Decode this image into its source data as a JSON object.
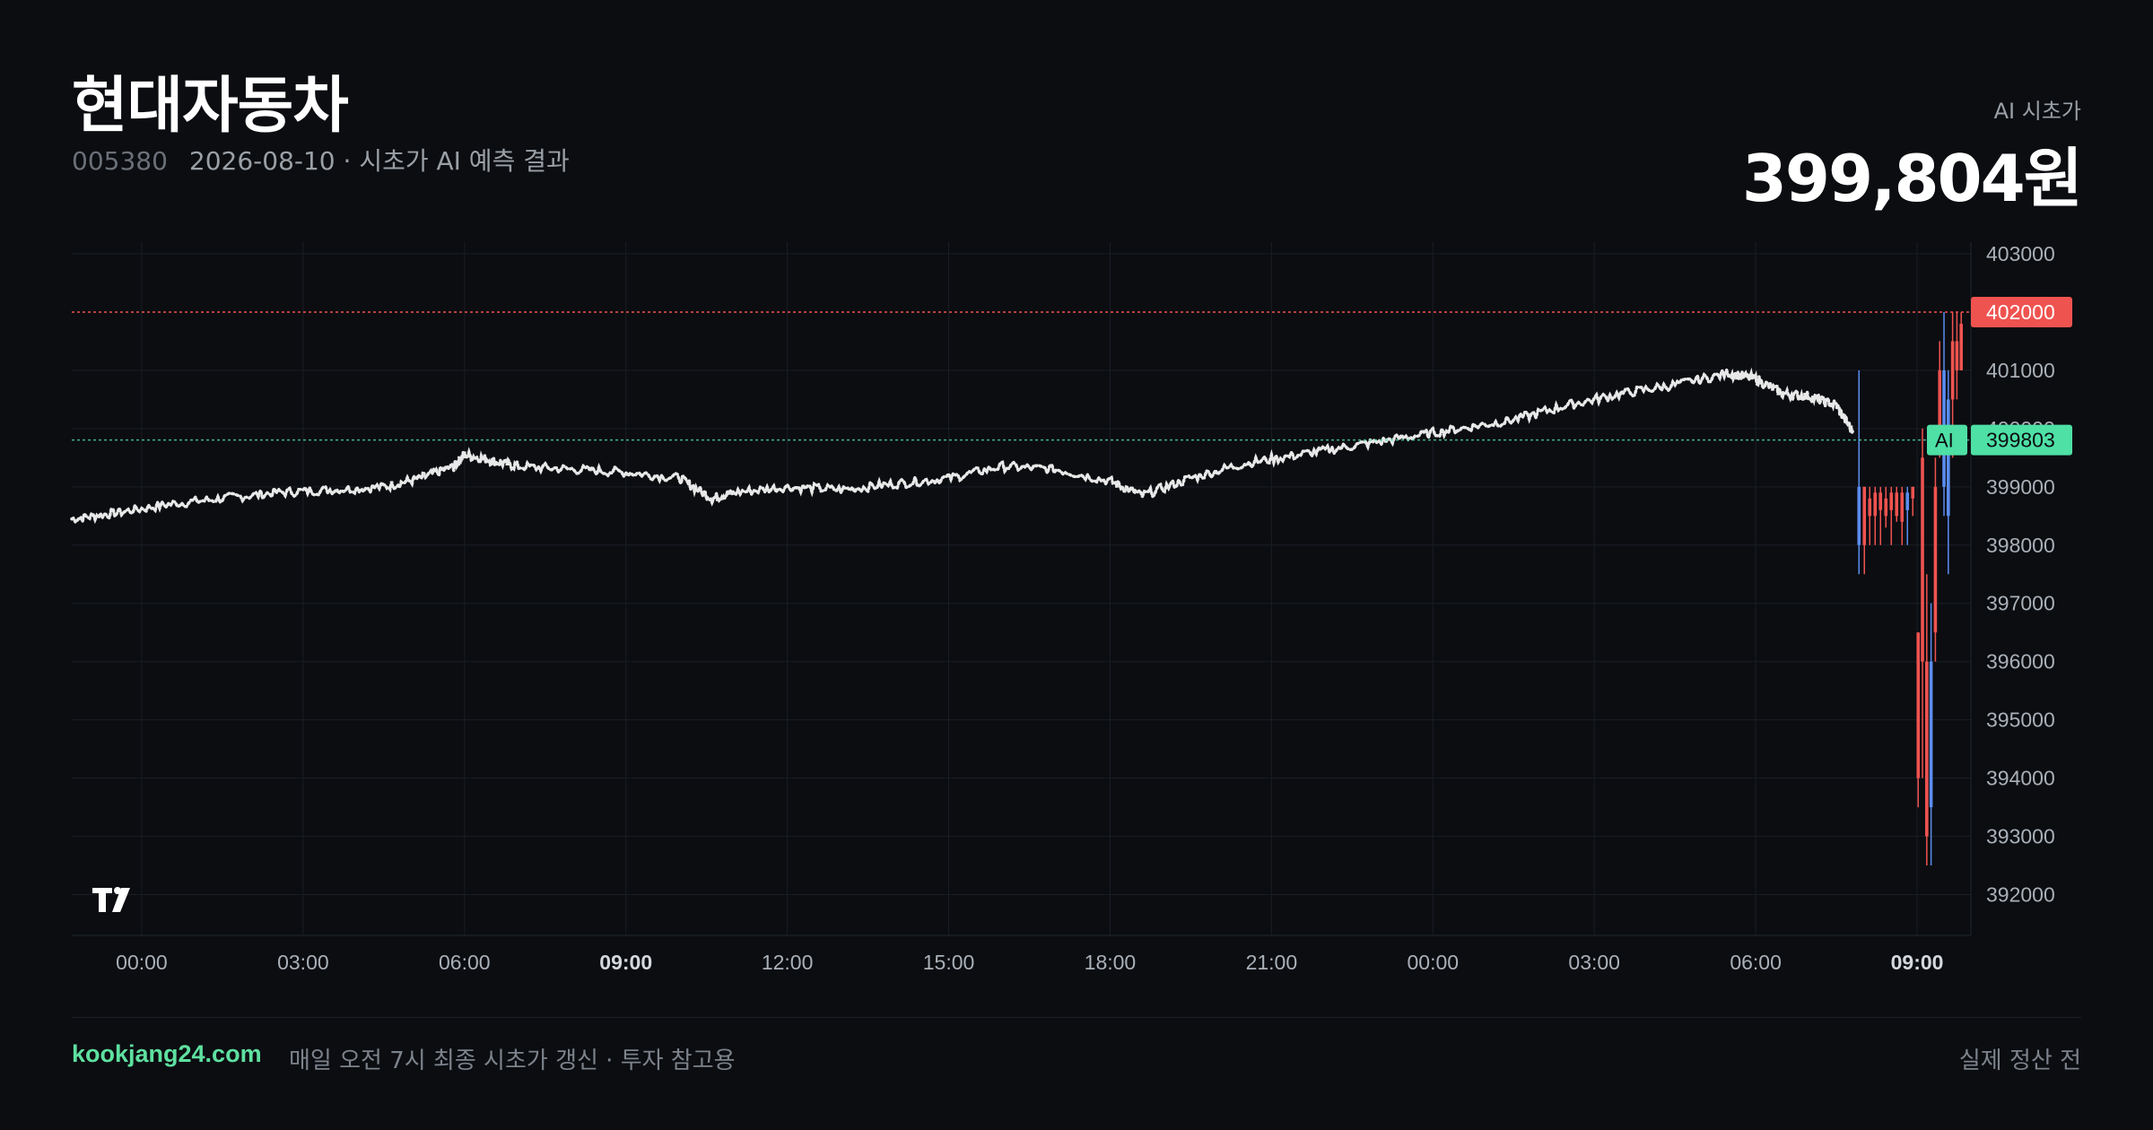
{
  "header": {
    "title": "현대자동차",
    "code": "005380",
    "subtitle": "2026-08-10 · 시초가 AI 예측 결과",
    "pred_label": "AI 시초가",
    "pred_value": "399,804원"
  },
  "footer": {
    "site": "kookjang24.com",
    "note": "매일 오전 7시 최종 시초가 갱신 · 투자 참고용",
    "status": "실제 정산 전"
  },
  "colors": {
    "background": "#0b0d11",
    "line": "#e8e8e8",
    "ref_line": "#ef5350",
    "ai_line": "#4ee0a5",
    "candle_up": "#ef5350",
    "candle_down": "#5b8def",
    "grid": "#1a1e25"
  },
  "chart_data": {
    "type": "line",
    "ylim": [
      391300,
      403200
    ],
    "yticks": [
      403000,
      401000,
      399000,
      398000,
      397000,
      396000,
      395000,
      394000,
      393000,
      392000
    ],
    "xticks": [
      {
        "t": 0,
        "label": "00:00",
        "bold": false
      },
      {
        "t": 3,
        "label": "03:00",
        "bold": false
      },
      {
        "t": 6,
        "label": "06:00",
        "bold": false
      },
      {
        "t": 9,
        "label": "09:00",
        "bold": true
      },
      {
        "t": 12,
        "label": "12:00",
        "bold": false
      },
      {
        "t": 15,
        "label": "15:00",
        "bold": false
      },
      {
        "t": 18,
        "label": "18:00",
        "bold": false
      },
      {
        "t": 21,
        "label": "21:00",
        "bold": false
      },
      {
        "t": 24,
        "label": "00:00",
        "bold": false
      },
      {
        "t": 27,
        "label": "03:00",
        "bold": false
      },
      {
        "t": 30,
        "label": "06:00",
        "bold": false
      },
      {
        "t": 33,
        "label": "09:00",
        "bold": true
      }
    ],
    "xlim": [
      -1.3,
      34.0
    ],
    "ref_line": {
      "value": 402000,
      "label": "402000"
    },
    "ai_line": {
      "value": 399803,
      "label": "399803",
      "tag": "AI"
    },
    "series": [
      {
        "style": "dotted",
        "x": [
          -1.3,
          -0.5,
          0.5,
          1.5,
          2.5,
          3.5,
          4.5,
          5.2,
          5.8,
          6.0,
          6.5,
          7.0,
          8.0,
          9.0,
          10.0,
          10.6,
          11.0,
          12.0,
          13.0,
          14.0,
          15.0,
          16.0,
          17.0,
          18.0,
          18.6,
          19.5,
          20.5,
          21.5,
          22.5,
          23.5,
          24.5,
          25.5,
          26.5,
          27.5,
          28.5,
          29.5,
          30.0,
          30.5,
          31.0,
          31.5,
          31.8
        ],
        "y": [
          398450,
          398550,
          398700,
          398800,
          398900,
          398950,
          399000,
          399150,
          399350,
          399550,
          399450,
          399350,
          399300,
          399250,
          399150,
          398800,
          398900,
          399000,
          398950,
          399050,
          399150,
          399350,
          399300,
          399100,
          398850,
          399150,
          399400,
          399550,
          399700,
          399850,
          400000,
          400150,
          400400,
          400600,
          400750,
          400950,
          400850,
          400600,
          400550,
          400400,
          399950
        ]
      }
    ],
    "candles": [
      {
        "x": 31.92,
        "o": 398000,
        "h": 401000,
        "l": 397500,
        "c": 399000,
        "dir": "down"
      },
      {
        "x": 32.02,
        "o": 399000,
        "h": 399000,
        "l": 397500,
        "c": 398000,
        "dir": "up"
      },
      {
        "x": 32.12,
        "o": 398500,
        "h": 399000,
        "l": 398000,
        "c": 398800,
        "dir": "up"
      },
      {
        "x": 32.22,
        "o": 398500,
        "h": 399000,
        "l": 398000,
        "c": 398900,
        "dir": "up"
      },
      {
        "x": 32.32,
        "o": 398600,
        "h": 399000,
        "l": 398000,
        "c": 398900,
        "dir": "up"
      },
      {
        "x": 32.42,
        "o": 398500,
        "h": 399000,
        "l": 398300,
        "c": 398800,
        "dir": "up"
      },
      {
        "x": 32.52,
        "o": 398600,
        "h": 399000,
        "l": 398000,
        "c": 398900,
        "dir": "up"
      },
      {
        "x": 32.62,
        "o": 398500,
        "h": 399000,
        "l": 398400,
        "c": 398900,
        "dir": "up"
      },
      {
        "x": 32.72,
        "o": 398400,
        "h": 399000,
        "l": 398000,
        "c": 398900,
        "dir": "up"
      },
      {
        "x": 32.82,
        "o": 398900,
        "h": 399000,
        "l": 398000,
        "c": 398600,
        "dir": "down"
      },
      {
        "x": 32.92,
        "o": 398800,
        "h": 399000,
        "l": 398500,
        "c": 399000,
        "dir": "up"
      },
      {
        "x": 33.02,
        "o": 396500,
        "h": 396500,
        "l": 393500,
        "c": 394000,
        "dir": "up"
      },
      {
        "x": 33.1,
        "o": 399500,
        "h": 400000,
        "l": 394000,
        "c": 396000,
        "dir": "up"
      },
      {
        "x": 33.18,
        "o": 396000,
        "h": 397500,
        "l": 392500,
        "c": 393000,
        "dir": "up"
      },
      {
        "x": 33.26,
        "o": 393500,
        "h": 397000,
        "l": 392500,
        "c": 396000,
        "dir": "down"
      },
      {
        "x": 33.34,
        "o": 396500,
        "h": 399500,
        "l": 396000,
        "c": 399000,
        "dir": "up"
      },
      {
        "x": 33.42,
        "o": 400000,
        "h": 401500,
        "l": 399500,
        "c": 401000,
        "dir": "up"
      },
      {
        "x": 33.5,
        "o": 401000,
        "h": 402000,
        "l": 398500,
        "c": 399000,
        "dir": "down"
      },
      {
        "x": 33.58,
        "o": 398500,
        "h": 401000,
        "l": 397500,
        "c": 400500,
        "dir": "down"
      },
      {
        "x": 33.66,
        "o": 400500,
        "h": 402000,
        "l": 399500,
        "c": 401500,
        "dir": "up"
      },
      {
        "x": 33.74,
        "o": 401500,
        "h": 402000,
        "l": 400500,
        "c": 401000,
        "dir": "up"
      },
      {
        "x": 33.82,
        "o": 401000,
        "h": 402000,
        "l": 401000,
        "c": 401800,
        "dir": "up"
      }
    ]
  }
}
